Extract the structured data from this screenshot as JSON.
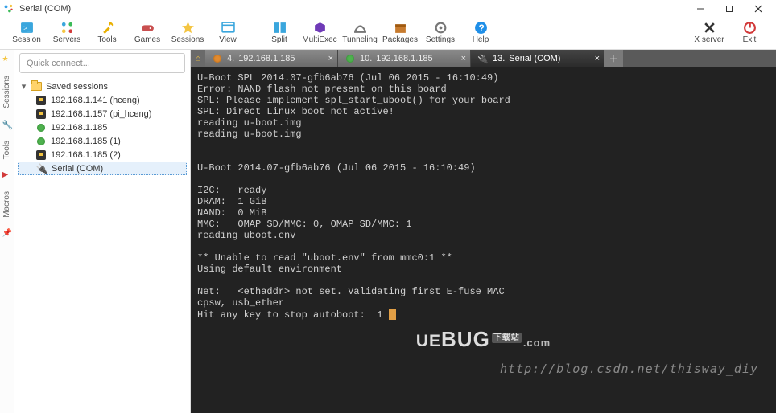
{
  "window": {
    "title": "Serial (COM)"
  },
  "toolbar": {
    "items": [
      {
        "label": "Session",
        "icon": "terminal-icon",
        "color": "#3aa6dd"
      },
      {
        "label": "Servers",
        "icon": "servers-icon",
        "color": "#3aa6dd"
      },
      {
        "label": "Tools",
        "icon": "tools-icon",
        "color": "#e9b000"
      },
      {
        "label": "Games",
        "icon": "games-icon",
        "color": "#c94f4f"
      },
      {
        "label": "Sessions",
        "icon": "star-icon",
        "color": "#f4c542"
      },
      {
        "label": "View",
        "icon": "view-icon",
        "color": "#3aa6dd"
      },
      {
        "label": "Split",
        "icon": "split-icon",
        "color": "#3aa6dd"
      },
      {
        "label": "MultiExec",
        "icon": "multiexec-icon",
        "color": "#6f3ab7"
      },
      {
        "label": "Tunneling",
        "icon": "tunneling-icon",
        "color": "#777"
      },
      {
        "label": "Packages",
        "icon": "packages-icon",
        "color": "#c77b2f"
      },
      {
        "label": "Settings",
        "icon": "settings-icon",
        "color": "#777"
      },
      {
        "label": "Help",
        "icon": "help-icon",
        "color": "#1f8fe8"
      }
    ],
    "right": [
      {
        "label": "X server",
        "icon": "x-icon",
        "color": "#333"
      },
      {
        "label": "Exit",
        "icon": "exit-icon",
        "color": "#d23a3a"
      }
    ]
  },
  "sidebar": {
    "quick_placeholder": "Quick connect...",
    "tabs": [
      "Sessions",
      "Tools",
      "Macros"
    ],
    "root": "Saved sessions",
    "items": [
      {
        "label": "192.168.1.141 (hceng)",
        "kind": "key"
      },
      {
        "label": "192.168.1.157 (pi_hceng)",
        "kind": "key"
      },
      {
        "label": "192.168.1.185",
        "kind": "green"
      },
      {
        "label": "192.168.1.185 (1)",
        "kind": "green"
      },
      {
        "label": "192.168.1.185 (2)",
        "kind": "key"
      },
      {
        "label": "Serial (COM)",
        "kind": "plug",
        "sel": true
      }
    ]
  },
  "tabs": [
    {
      "num": "4.",
      "label": "192.168.1.185",
      "kind": "orange",
      "active": false
    },
    {
      "num": "10.",
      "label": "192.168.1.185",
      "kind": "green",
      "active": false
    },
    {
      "num": "13.",
      "label": "Serial (COM)",
      "kind": "plug",
      "active": true
    }
  ],
  "terminal": {
    "lines": [
      "U-Boot SPL 2014.07-gfb6ab76 (Jul 06 2015 - 16:10:49)",
      "Error: NAND flash not present on this board",
      "SPL: Please implement spl_start_uboot() for your board",
      "SPL: Direct Linux boot not active!",
      "reading u-boot.img",
      "reading u-boot.img",
      "",
      "",
      "U-Boot 2014.07-gfb6ab76 (Jul 06 2015 - 16:10:49)",
      "",
      "I2C:   ready",
      "DRAM:  1 GiB",
      "NAND:  0 MiB",
      "MMC:   OMAP SD/MMC: 0, OMAP SD/MMC: 1",
      "reading uboot.env",
      "",
      "** Unable to read \"uboot.env\" from mmc0:1 **",
      "Using default environment",
      "",
      "Net:   <ethaddr> not set. Validating first E-fuse MAC",
      "cpsw, usb_ether",
      "Hit any key to stop autoboot:  1 "
    ],
    "watermark": "http://blog.csdn.net/thisway_diy",
    "logo": {
      "pre": "UE",
      "mid": "BUG",
      "suf": ".com",
      "tag": "下载站"
    }
  }
}
